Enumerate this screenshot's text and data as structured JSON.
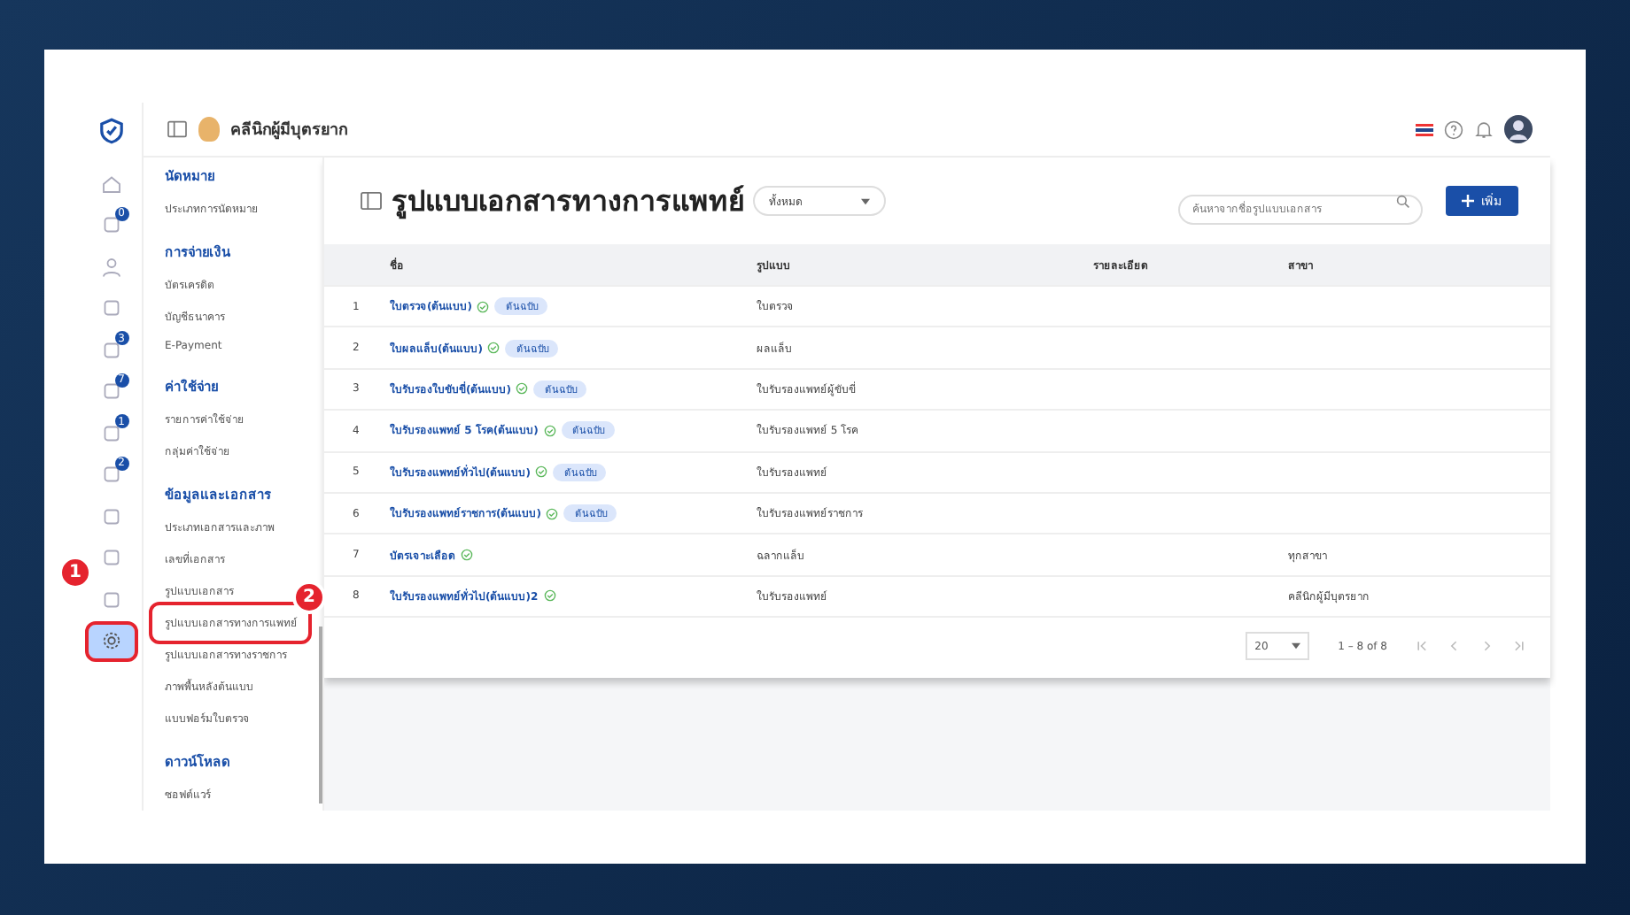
{
  "header": {
    "clinic_name": "คลีนิกผู้มีบุตรยาก"
  },
  "rail": [
    {
      "selected": false
    },
    {
      "badge": "0",
      "selected": false
    },
    {
      "selected": false
    },
    {
      "selected": false
    },
    {
      "badge": "3",
      "selected": false
    },
    {
      "badge": "7",
      "selected": false
    },
    {
      "badge": "1",
      "selected": false
    },
    {
      "badge": "2",
      "selected": false
    },
    {
      "selected": false
    },
    {
      "selected": false
    },
    {
      "selected": false
    },
    {
      "selected": true
    }
  ],
  "menu": [
    {
      "title": "นัดหมาย",
      "items": [
        {
          "label": "ประเภทการนัดหมาย",
          "selected": false
        }
      ]
    },
    {
      "title": "การจ่ายเงิน",
      "items": [
        {
          "label": "บัตรเครดิต",
          "selected": false
        },
        {
          "label": "บัญชีธนาคาร",
          "selected": false
        },
        {
          "label": "E-Payment",
          "selected": false
        }
      ]
    },
    {
      "title": "ค่าใช้จ่าย",
      "items": [
        {
          "label": "รายการค่าใช้จ่าย",
          "selected": false
        },
        {
          "label": "กลุ่มค่าใช้จ่าย",
          "selected": false
        }
      ]
    },
    {
      "title": "ข้อมูลและเอกสาร",
      "items": [
        {
          "label": "ประเภทเอกสารและภาพ",
          "selected": false
        },
        {
          "label": "เลขที่เอกสาร",
          "selected": false
        },
        {
          "label": "รูปแบบเอกสาร",
          "selected": false
        },
        {
          "label": "รูปแบบเอกสารทางการแพทย์",
          "selected": true
        },
        {
          "label": "รูปแบบเอกสารทางราชการ",
          "selected": false
        },
        {
          "label": "ภาพพื้นหลังต้นแบบ",
          "selected": false
        },
        {
          "label": "แบบฟอร์มใบตรวจ",
          "selected": false
        }
      ]
    },
    {
      "title": "ดาวน์โหลด",
      "items": [
        {
          "label": "ซอฟต์แวร์",
          "selected": false
        }
      ]
    }
  ],
  "annotations": [
    {
      "label": "1"
    },
    {
      "label": "2"
    }
  ],
  "page": {
    "title": "รูปแบบเอกสารทางการแพทย์",
    "filter": "ทั้งหมด",
    "search_placeholder": "ค้นหาจากชื่อรูปแบบเอกสาร",
    "add_button": "เพิ่ม"
  },
  "table": {
    "columns": [
      "ชื่อ",
      "รูปแบบ",
      "รายละเอียด",
      "สาขา"
    ],
    "rows": [
      {
        "no": "1",
        "name": "ใบตรวจ(ต้นแบบ)",
        "verified": true,
        "badge": "ต้นฉบับ",
        "format": "ใบตรวจ",
        "branch": null
      },
      {
        "no": "2",
        "name": "ใบผลแล็บ(ต้นแบบ)",
        "verified": true,
        "badge": "ต้นฉบับ",
        "format": "ผลแล็บ",
        "branch": null
      },
      {
        "no": "3",
        "name": "ใบรับรองใบขับขี่(ต้นแบบ)",
        "verified": true,
        "badge": "ต้นฉบับ",
        "format": "ใบรับรองแพทย์ผู้ขับขี่",
        "branch": null
      },
      {
        "no": "4",
        "name": "ใบรับรองแพทย์ 5 โรค(ต้นแบบ)",
        "verified": true,
        "badge": "ต้นฉบับ",
        "format": "ใบรับรองแพทย์ 5 โรค",
        "branch": null
      },
      {
        "no": "5",
        "name": "ใบรับรองแพทย์ทั่วไป(ต้นแบบ)",
        "verified": true,
        "badge": "ต้นฉบับ",
        "format": "ใบรับรองแพทย์",
        "branch": null
      },
      {
        "no": "6",
        "name": "ใบรับรองแพทย์ราชการ(ต้นแบบ)",
        "verified": true,
        "badge": "ต้นฉบับ",
        "format": "ใบรับรองแพทย์ราชการ",
        "branch": null
      },
      {
        "no": "7",
        "name": "บัตรเจาะเลือด",
        "verified": true,
        "badge": null,
        "format": "ฉลากแล็บ",
        "branch": "ทุกสาขา"
      },
      {
        "no": "8",
        "name": "ใบรับรองแพทย์ทั่วไป(ต้นแบบ)2",
        "verified": true,
        "badge": null,
        "format": "ใบรับรองแพทย์",
        "branch": "คลีนิกผู้มีบุตรยาก"
      }
    ]
  },
  "pagination": {
    "page_size": "20",
    "range": "1 – 8 of 8"
  }
}
